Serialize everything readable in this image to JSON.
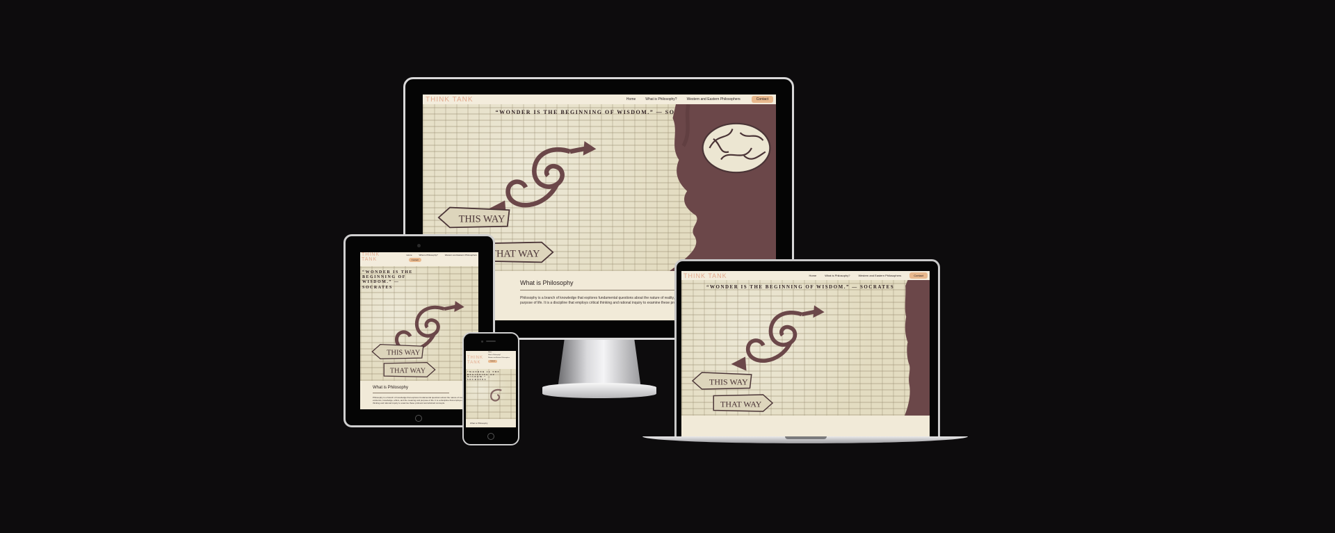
{
  "site": {
    "logo": "THINK TANK",
    "nav": [
      "Home",
      "What is Philosophy?",
      "Western and Eastern Philosophers"
    ],
    "contact": "Contact",
    "quote": "“WONDER IS THE BEGINNING OF WISDOM.” — SOCRATES",
    "quote_phone": "“WONDER IS THE BEGINNING OF WISDOM.” — SOCRATES",
    "arrow_top": "THIS WAY",
    "arrow_bottom": "THAT WAY",
    "section_title": "What is Philosophy",
    "section_body": "Philosophy is a branch of knowledge that explores fundamental questions about the nature of reality, existence, knowledge, ethics, and the meaning and purpose of life. It is a discipline that employs critical thinking and rational inquiry to examine these profound and abstract concepts."
  },
  "colors": {
    "page_bg": "#0d0c0d",
    "logo": "#e2a98d",
    "contact_button": "#e8b88d",
    "silhouette": "#6b4749",
    "hero_bg": "#e3dcc1",
    "nav_bg": "#f3ecdc"
  },
  "icons": [
    "brain-icon",
    "spiral-arrow-icon",
    "this-way-sign-icon",
    "that-way-sign-icon",
    "home-button-icon",
    "camera-icon"
  ]
}
